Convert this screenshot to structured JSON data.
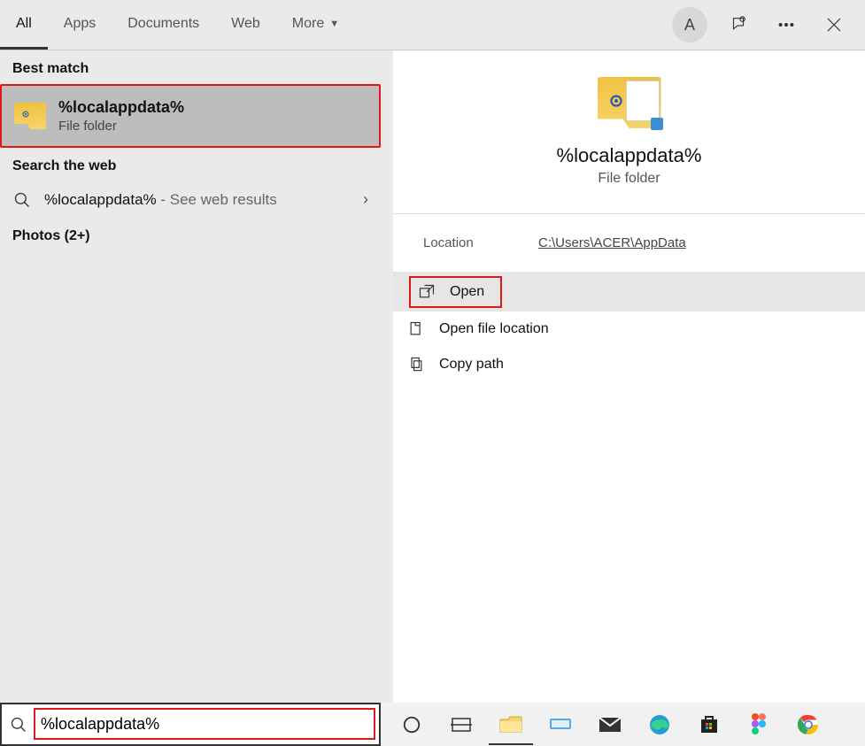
{
  "tabs": {
    "all": "All",
    "apps": "Apps",
    "documents": "Documents",
    "web": "Web",
    "more": "More"
  },
  "avatar_initial": "A",
  "left": {
    "best_match_header": "Best match",
    "best_match": {
      "title": "%localappdata%",
      "subtitle": "File folder"
    },
    "search_web_header": "Search the web",
    "web_result": {
      "query": "%localappdata%",
      "suffix": " - See web results"
    },
    "photos_header": "Photos (2+)"
  },
  "preview": {
    "title": "%localappdata%",
    "subtitle": "File folder",
    "location_label": "Location",
    "location_value": "C:\\Users\\ACER\\AppData",
    "actions": {
      "open": "Open",
      "open_file_location": "Open file location",
      "copy_path": "Copy path"
    }
  },
  "search_value": "%localappdata%"
}
